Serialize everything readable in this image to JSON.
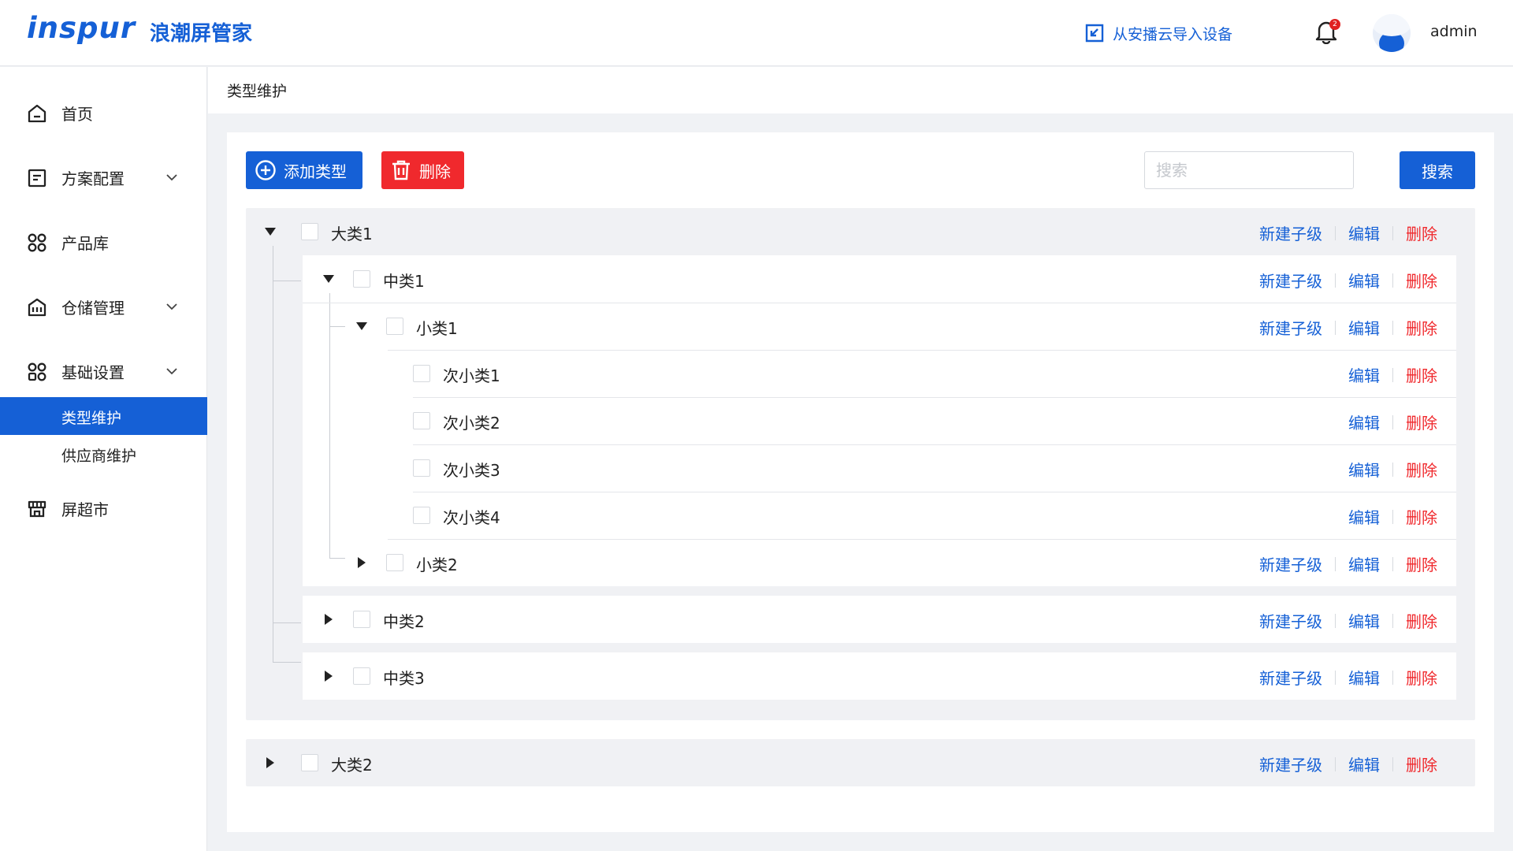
{
  "header": {
    "logo_text": "inspur",
    "app_name": "浪潮屏管家",
    "import_label": "从安播云导入设备",
    "notification_count": "2",
    "username": "admin"
  },
  "sidebar": {
    "items": [
      {
        "label": "首页",
        "icon": "home-icon"
      },
      {
        "label": "方案配置",
        "icon": "document-icon"
      },
      {
        "label": "产品库",
        "icon": "grid-icon"
      },
      {
        "label": "仓储管理",
        "icon": "warehouse-icon"
      },
      {
        "label": "基础设置",
        "icon": "grid-icon"
      },
      {
        "label": "屏超市",
        "icon": "store-icon"
      }
    ],
    "sub_items": [
      {
        "label": "类型维护",
        "active": true
      },
      {
        "label": "供应商维护",
        "active": false
      }
    ]
  },
  "breadcrumb": "类型维护",
  "toolbar": {
    "add_label": "添加类型",
    "delete_label": "删除",
    "search_placeholder": "搜索",
    "search_button": "搜索"
  },
  "actions": {
    "new_child": "新建子级",
    "edit": "编辑",
    "delete": "删除"
  },
  "tree": {
    "l1_1": "大类1",
    "l2_1": "中类1",
    "l3_1": "小类1",
    "l4_1": "次小类1",
    "l4_2": "次小类2",
    "l4_3": "次小类3",
    "l4_4": "次小类4",
    "l3_2": "小类2",
    "l2_2": "中类2",
    "l2_3": "中类3",
    "l1_2": "大类2"
  },
  "colors": {
    "primary": "#1560d6",
    "danger": "#f0292d"
  }
}
